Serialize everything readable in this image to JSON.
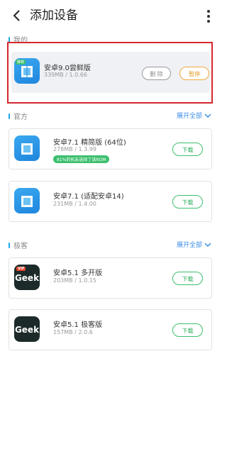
{
  "header": {
    "title": "添加设备",
    "back_icon": "chevron-left-icon",
    "more_icon": "more-vertical-icon"
  },
  "sections": {
    "mine": {
      "label": "我的"
    },
    "official": {
      "label": "官方",
      "expand": "展开全部"
    },
    "geek": {
      "label": "极客",
      "expand": "展开全部"
    }
  },
  "mine_item": {
    "badge": "推荐",
    "name": "安卓9.0尝鲜版",
    "meta": "339MB / 1.0.66",
    "delete_label": "删 除",
    "pause_label": "暂停"
  },
  "official_items": [
    {
      "name": "安卓7.1 精简版 (64位)",
      "meta": "278MB / 1.3.99",
      "tag": "81%的机友选择了该ROM",
      "action": "下载"
    },
    {
      "name": "安卓7.1 (适配安卓14)",
      "meta": "231MB / 1.4.00",
      "action": "下载"
    }
  ],
  "geek_items": [
    {
      "vip": "VIP",
      "logo": "Geek",
      "name": "安卓5.1 多开版",
      "meta": "203MB / 1.0.15",
      "action": "下载"
    },
    {
      "logo": "Geek",
      "name": "安卓5.1 极客版",
      "meta": "157MB / 2.0.6",
      "action": "下载"
    }
  ],
  "colors": {
    "accent_blue": "#3c8ee6",
    "download_green": "#3cbf6e",
    "pause_orange": "#efa83c",
    "highlight_red": "#d3282e"
  }
}
